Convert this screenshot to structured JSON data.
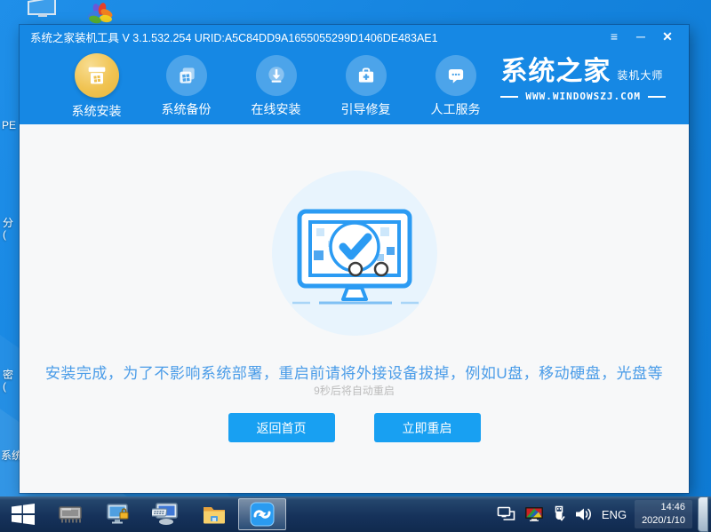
{
  "window": {
    "title": "系统之家装机工具 V 3.1.532.254 URID:A5C84DD9A1655055299D1406DE483AE1",
    "controls": {
      "menu": "≡",
      "minimize": "─",
      "close": "✕"
    }
  },
  "nav": {
    "items": [
      {
        "label": "系统安装",
        "icon": "system-install-icon",
        "active": true
      },
      {
        "label": "系统备份",
        "icon": "system-backup-icon",
        "active": false
      },
      {
        "label": "在线安装",
        "icon": "online-install-icon",
        "active": false
      },
      {
        "label": "引导修复",
        "icon": "boot-repair-icon",
        "active": false
      },
      {
        "label": "人工服务",
        "icon": "support-chat-icon",
        "active": false
      }
    ],
    "logo": {
      "title": "系统之家",
      "subtitle": "装机大师",
      "site": "WWW.WINDOWSZJ.COM"
    }
  },
  "main": {
    "message": "安装完成，为了不影响系统部署，重启前请将外接设备拔掉，例如U盘，移动硬盘，光盘等",
    "countdown": "9秒后将自动重启",
    "buttons": [
      {
        "label": "返回首页"
      },
      {
        "label": "立即重启"
      }
    ]
  },
  "desktop": {
    "fragments": [
      "PE",
      "分\n(",
      "密\n(",
      "系统"
    ]
  },
  "taskbar": {
    "tray": {
      "language": "ENG",
      "time": "14:46",
      "date": "2020/1/10"
    }
  },
  "colors": {
    "header_blue": "#1688e4",
    "desktop_blue": "#1584df",
    "accent_blue": "#2b9bf3",
    "button_blue": "#18a0f2",
    "active_gold": "#f0c351",
    "taskbar_navy": "#16325b",
    "message_blue": "#4a9ce8",
    "muted_gray": "#bcbcbc"
  }
}
